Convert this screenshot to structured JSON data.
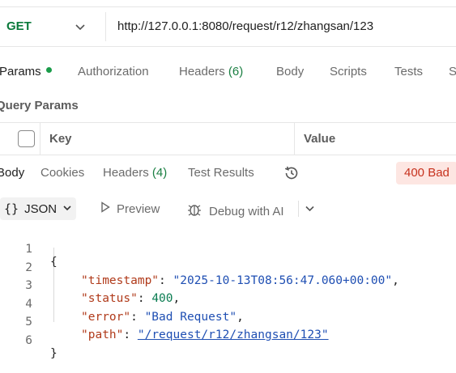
{
  "request": {
    "method": "GET",
    "url": "http://127.0.0.1:8080/request/r12/zhangsan/123"
  },
  "request_tabs": [
    {
      "label": "Params",
      "active": true,
      "indicator": "green-dot"
    },
    {
      "label": "Authorization"
    },
    {
      "label": "Headers",
      "count": "(6)"
    },
    {
      "label": "Body"
    },
    {
      "label": "Scripts"
    },
    {
      "label": "Tests"
    },
    {
      "label": "S"
    }
  ],
  "query_params": {
    "title": "Query Params",
    "columns": [
      "Key",
      "Value"
    ]
  },
  "response_tabs": [
    {
      "label": "Body",
      "active": true
    },
    {
      "label": "Cookies"
    },
    {
      "label": "Headers",
      "count": "(4)"
    },
    {
      "label": "Test Results"
    }
  ],
  "status_badge": "400 Bad",
  "toolbar": {
    "format_braces": "{}",
    "format_label": "JSON",
    "preview_label": "Preview",
    "debug_label": "Debug with AI"
  },
  "response_body": {
    "line_numbers": [
      "1",
      "2",
      "3",
      "4",
      "5",
      "6"
    ],
    "open_brace": "{",
    "close_brace": "}",
    "fields": [
      {
        "key": "\"timestamp\"",
        "value": "\"2025-10-13T08:56:47.060+00:00\"",
        "type": "string",
        "trail": ","
      },
      {
        "key": "\"status\"",
        "value": "400",
        "type": "number",
        "trail": ","
      },
      {
        "key": "\"error\"",
        "value": "\"Bad Request\"",
        "type": "string",
        "trail": ","
      },
      {
        "key": "\"path\"",
        "value": "\"/request/r12/zhangsan/123\"",
        "type": "link",
        "trail": ""
      }
    ]
  },
  "colors": {
    "method_get": "#0b7a3b",
    "params_dot": "#1a9c4a",
    "status_bg": "#fde6e2",
    "status_text": "#c7321e",
    "json_key": "#b03a1a",
    "json_string": "#1f4fb3",
    "json_number": "#0b7d52"
  }
}
